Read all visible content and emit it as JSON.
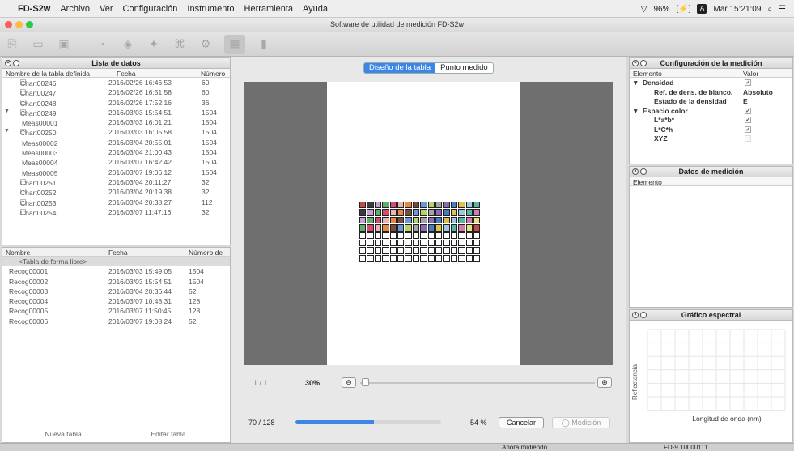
{
  "menubar": {
    "app_name": "FD-S2w",
    "items": [
      "Archivo",
      "Ver",
      "Configuración",
      "Instrumento",
      "Herramienta",
      "Ayuda"
    ],
    "battery": "96%",
    "clock": "Mar 15:21:09"
  },
  "window": {
    "title": "Software de utilidad de medición FD-S2w"
  },
  "data_list": {
    "title": "Lista de datos",
    "columns": [
      "Nombre de la tabla definida",
      "Fecha",
      "Número"
    ],
    "rows": [
      {
        "name": "Chart00246",
        "date": "2016/02/26 16:46:53",
        "num": "60"
      },
      {
        "name": "Chart00247",
        "date": "2016/02/26 16:51:58",
        "num": "60"
      },
      {
        "name": "Chart00248",
        "date": "2016/02/26 17:52:16",
        "num": "36"
      },
      {
        "name": "Chart00249",
        "date": "2016/03/03 15:54:51",
        "num": "1504"
      },
      {
        "name": "Meas00001",
        "date": "2016/03/03 16:01:21",
        "num": "1504"
      },
      {
        "name": "Chart00250",
        "date": "2016/03/03 16:05:58",
        "num": "1504"
      },
      {
        "name": "Meas00002",
        "date": "2016/03/04 20:55:01",
        "num": "1504"
      },
      {
        "name": "Meas00003",
        "date": "2016/03/04 21:00:43",
        "num": "1504"
      },
      {
        "name": "Meas00004",
        "date": "2016/03/07 16:42:42",
        "num": "1504"
      },
      {
        "name": "Meas00005",
        "date": "2016/03/07 19:06:12",
        "num": "1504"
      },
      {
        "name": "Chart00251",
        "date": "2016/03/04 20:11:27",
        "num": "32"
      },
      {
        "name": "Chart00252",
        "date": "2016/03/04 20:19:38",
        "num": "32"
      },
      {
        "name": "Chart00253",
        "date": "2016/03/04 20:38:27",
        "num": "112"
      },
      {
        "name": "Chart00254",
        "date": "2016/03/07 11:47:16",
        "num": "32"
      }
    ]
  },
  "free_list": {
    "columns": [
      "Nombre",
      "Fecha",
      "Número de"
    ],
    "free_form": "<Tabla de forma libre>",
    "rows": [
      {
        "name": "Recog00001",
        "date": "2016/03/03 15:49:05",
        "num": "1504"
      },
      {
        "name": "Recog00002",
        "date": "2016/03/03 15:54:51",
        "num": "1504"
      },
      {
        "name": "Recog00003",
        "date": "2016/03/04 20:36:44",
        "num": "52"
      },
      {
        "name": "Recog00004",
        "date": "2016/03/07 10:48:31",
        "num": "128"
      },
      {
        "name": "Recog00005",
        "date": "2016/03/07 11:50:45",
        "num": "128"
      },
      {
        "name": "Recog00006",
        "date": "2016/03/07 19:08:24",
        "num": "52"
      }
    ],
    "new_button": "Nueva tabla",
    "edit_button": "Editar tabla"
  },
  "center": {
    "tabs": [
      "Diseño de la tabla",
      "Punto medido"
    ],
    "page_counter": "1 / 1",
    "zoom": "30%",
    "progress_count": "70 / 128",
    "progress_percent": "54  %",
    "progress_fraction": 0.54,
    "cancel_button": "Cancelar",
    "measure_button": "Medición"
  },
  "config": {
    "title": "Configuración de la medición",
    "columns": [
      "Elemento",
      "Valor"
    ]
  },
  "config_rows": {
    "densidad": "Densidad",
    "ref": "Ref. de dens. de blanco.",
    "ref_value": "Absoluto",
    "estado": "Estado de la densidad",
    "estado_value": "E",
    "espacio": "Espacio color",
    "lab": "L*a*b*",
    "lch": "L*C*h",
    "xyz": "XYZ"
  },
  "measurement": {
    "title": "Datos de medición",
    "column": "Elemento"
  },
  "spectral": {
    "title": "Gráfico espectral",
    "ylabel": "Reflectancia",
    "xlabel": "Longitud de onda (nm)"
  },
  "status": {
    "center": "Ahora midiendo...",
    "right": "FD-9 10000111"
  },
  "colors": {
    "accent": "#3b86e6",
    "swatches": [
      "#c44a4a",
      "#e0c24a",
      "#6a9ad6",
      "#5fae6a",
      "#d57ab0",
      "#8c6bb5",
      "#e38a3c",
      "#3c3c3c",
      "#9cc8e4",
      "#b4d46a",
      "#d64a6c",
      "#e8e07a",
      "#4a7ac4",
      "#7a4a3c",
      "#c8a0d8",
      "#5ab4a4",
      "#a4a4a4",
      "#e8b4b4"
    ]
  }
}
